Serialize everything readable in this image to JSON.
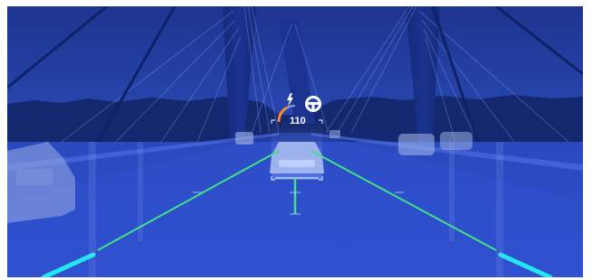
{
  "scene": {
    "title": "",
    "colors": {
      "sky": "#2442b0",
      "road": "#2c4bc6",
      "lane_green": "#41e08a",
      "lane_cyan": "#23e6f3",
      "hud_white": "#ffffff",
      "hud_orange": "#ff8a2a"
    }
  },
  "hud": {
    "speed_value": "110",
    "speed_gauge_fraction": 0.45,
    "steering_icon": "steering-wheel-icon",
    "assist_icon": "lightning-icon"
  }
}
